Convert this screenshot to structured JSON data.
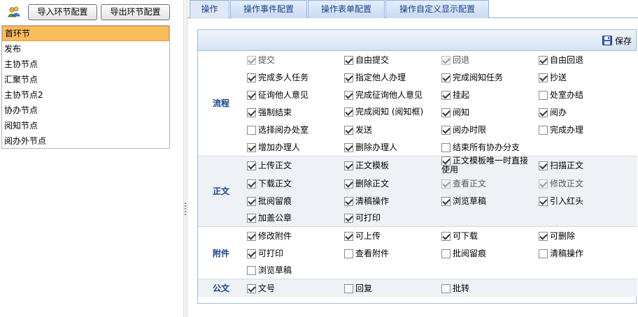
{
  "left_panel": {
    "import_button": "导入环节配置",
    "export_button": "导出环节配置",
    "nodes": [
      "首环节",
      "发布",
      "主协节点",
      "汇聚节点",
      "主协节点2",
      "协办节点",
      "阅知节点",
      "阅办外节点"
    ],
    "selected_index": 0
  },
  "tabs": [
    "操作",
    "操作事件配置",
    "操作表单配置",
    "操作自定义显示配置"
  ],
  "active_tab": 0,
  "save_label": "保存",
  "sections": [
    {
      "title": "流程",
      "rows": [
        [
          {
            "label": "提交",
            "checked": true,
            "disabled": true
          },
          {
            "label": "自由提交",
            "checked": true
          },
          {
            "label": "回退",
            "checked": true,
            "disabled": true
          },
          {
            "label": "自由回退",
            "checked": true
          }
        ],
        [
          {
            "label": "完成多人任务",
            "checked": true
          },
          {
            "label": "指定他人办理",
            "checked": true
          },
          {
            "label": "完成阅知任务",
            "checked": true
          },
          {
            "label": "抄送",
            "checked": true
          }
        ],
        [
          {
            "label": "征询他人意见",
            "checked": true
          },
          {
            "label": "完成征询他人意见",
            "checked": true
          },
          {
            "label": "挂起",
            "checked": true
          },
          {
            "label": "处室办结",
            "checked": false
          }
        ],
        [
          {
            "label": "强制结束",
            "checked": true
          },
          {
            "label": "完成阅知 (阅知框)",
            "checked": true
          },
          {
            "label": "阅知",
            "checked": true
          },
          {
            "label": "阅办",
            "checked": true
          }
        ],
        [
          {
            "label": "选择阅办处室",
            "checked": false
          },
          {
            "label": "发送",
            "checked": true
          },
          {
            "label": "阅办时限",
            "checked": true
          },
          {
            "label": "完成办理",
            "checked": false
          }
        ],
        [
          {
            "label": "增加办理人",
            "checked": true
          },
          {
            "label": "删除办理人",
            "checked": true
          },
          {
            "label": "结束所有协办分支",
            "checked": false
          }
        ]
      ]
    },
    {
      "title": "正文",
      "rows": [
        [
          {
            "label": "上传正文",
            "checked": true
          },
          {
            "label": "正文模板",
            "checked": true
          },
          {
            "label": "正文模板唯一时直接使用",
            "checked": true
          },
          {
            "label": "扫描正文",
            "checked": true
          }
        ],
        [
          {
            "label": "下载正文",
            "checked": true
          },
          {
            "label": "删除正文",
            "checked": true
          },
          {
            "label": "查看正文",
            "checked": true,
            "disabled": true
          },
          {
            "label": "修改正文",
            "checked": true,
            "disabled": true
          }
        ],
        [
          {
            "label": "批阅留痕",
            "checked": true
          },
          {
            "label": "清稿操作",
            "checked": true
          },
          {
            "label": "浏览草稿",
            "checked": true
          },
          {
            "label": "引入红头",
            "checked": true
          }
        ],
        [
          {
            "label": "加盖公章",
            "checked": true
          },
          {
            "label": "可打印",
            "checked": true
          }
        ]
      ]
    },
    {
      "title": "附件",
      "rows": [
        [
          {
            "label": "修改附件",
            "checked": true
          },
          {
            "label": "可上传",
            "checked": true
          },
          {
            "label": "可下载",
            "checked": true
          },
          {
            "label": "可删除",
            "checked": true
          }
        ],
        [
          {
            "label": "可打印",
            "checked": true
          },
          {
            "label": "查看附件",
            "checked": false
          },
          {
            "label": "批阅留痕",
            "checked": false
          },
          {
            "label": "清稿操作",
            "checked": false
          }
        ],
        [
          {
            "label": "浏览草稿",
            "checked": false
          }
        ]
      ]
    },
    {
      "title": "公文",
      "rows": [
        [
          {
            "label": "文号",
            "checked": true
          },
          {
            "label": "回复",
            "checked": false
          },
          {
            "label": "批转",
            "checked": false
          }
        ]
      ]
    }
  ]
}
